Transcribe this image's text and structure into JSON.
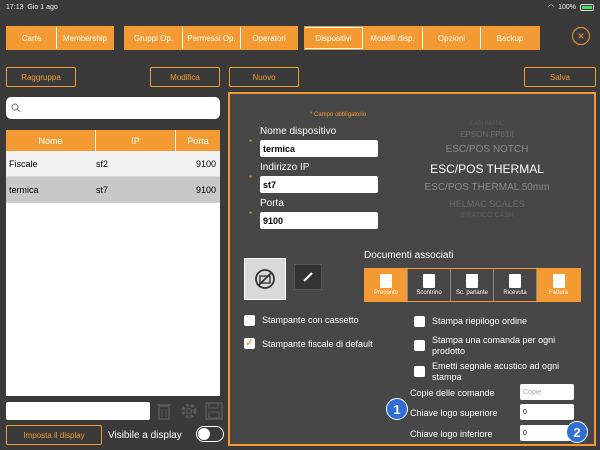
{
  "status": {
    "time": "17:13",
    "date": "Gio 1 ago",
    "battery": "100%"
  },
  "nav": {
    "group1": [
      "Carte",
      "Membership"
    ],
    "group2": [
      "Gruppi Op.",
      "Permessi Op.",
      "Operatori"
    ],
    "group3": [
      "Dispositivi",
      "Modelli disp.",
      "Opzioni",
      "Backup"
    ],
    "active": "Dispositivi"
  },
  "toolbar": {
    "raggruppa": "Raggruppa",
    "modifica": "Modifica",
    "nuovo": "Nuovo",
    "salva": "Salva"
  },
  "search": {
    "placeholder": ""
  },
  "table": {
    "headers": [
      "Nome",
      "IP",
      "Porta"
    ],
    "rows": [
      {
        "nome": "Fiscale",
        "ip": "sf2",
        "porta": "9100"
      },
      {
        "nome": "termica",
        "ip": "st7",
        "porta": "9100"
      }
    ]
  },
  "bottom": {
    "imposta": "Imposta il display",
    "visibile": "Visibile a display"
  },
  "form": {
    "required_note": "* Campo obbligatorio",
    "nome_label": "Nome dispositivo",
    "nome_value": "termica",
    "ip_label": "Indirizzo IP",
    "ip_value": "st7",
    "porta_label": "Porta",
    "porta_value": "9100",
    "star": "*"
  },
  "drivers": [
    "CASHMATIC",
    "EPSON FP81II",
    "ESC/POS NOTCH",
    "ESC/POS THERMAL",
    "ESC/POS THERMAL 50mm",
    "HELMAC SCALES",
    "IPRATICO CASH"
  ],
  "documents": {
    "title": "Documenti associati",
    "items": [
      "Preconto",
      "Scontrino",
      "Sc. parlante",
      "Ricevuta",
      "Fattura"
    ]
  },
  "options": {
    "cassetto": "Stampante con cassetto",
    "fiscale": "Stampante fiscale di default",
    "riepilogo": "Stampa riepilogo ordine",
    "comanda": "Stampa una comanda per ogni prodotto",
    "segnale": "Emetti segnale acustico ad ogni stampa",
    "copie_label": "Copie delle comande",
    "copie_placeholder": "Copie",
    "logo_sup_label": "Chiave logo superiore",
    "logo_sup_value": "0",
    "logo_inf_label": "Chiave logo inferiore",
    "logo_inf_value": "0"
  },
  "badges": [
    "1",
    "2"
  ],
  "colors": {
    "accent": "#f39b32",
    "background": "#3a3a3a",
    "panel": "#474747",
    "badge": "#2f6fd6"
  }
}
